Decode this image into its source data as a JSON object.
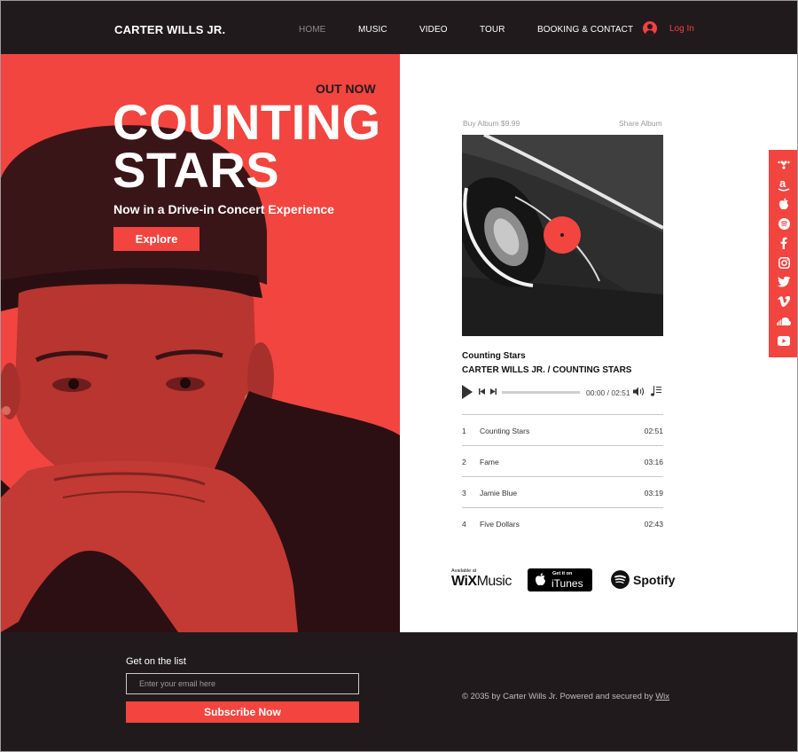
{
  "header": {
    "logo": "CARTER WILLS JR.",
    "nav": [
      {
        "label": "HOME",
        "active": true
      },
      {
        "label": "MUSIC",
        "active": false
      },
      {
        "label": "VIDEO",
        "active": false
      },
      {
        "label": "TOUR",
        "active": false
      },
      {
        "label": "BOOKING & CONTACT",
        "active": false
      }
    ],
    "login_label": "Log In",
    "login_icon": "user-avatar-icon"
  },
  "hero": {
    "out_now": "OUT NOW",
    "title_line1": "COUNTING",
    "title_line2": "STARS",
    "subtitle": "Now in a Drive-in Concert Experience",
    "cta_label": "Explore",
    "image_description": "Red-duotone portrait of man in cap, hands clasped over mouth"
  },
  "album": {
    "buy_label": "Buy Album $9.99",
    "share_label": "Share Album",
    "cover_description": "Black and white car wheel with red record dot"
  },
  "player": {
    "track_title": "Counting Stars",
    "track_artist": "CARTER WILLS JR. / COUNTING STARS",
    "time": "00:00 / 02:51",
    "progress": 0
  },
  "tracks": [
    {
      "num": "1",
      "name": "Counting Stars",
      "duration": "02:51"
    },
    {
      "num": "2",
      "name": "Fame",
      "duration": "03:16"
    },
    {
      "num": "3",
      "name": "Jamie Blue",
      "duration": "03:19"
    },
    {
      "num": "4",
      "name": "Five Dollars",
      "duration": "02:43"
    }
  ],
  "badges": {
    "wix_available": "Available at",
    "wix_brand_bold": "WiX",
    "wix_brand_light": "Music",
    "itunes_get": "Get it on",
    "itunes_label": "iTunes",
    "spotify_label": "Spotify"
  },
  "social": [
    "tidal-icon",
    "amazon-icon",
    "apple-icon",
    "spotify-icon",
    "facebook-icon",
    "instagram-icon",
    "twitter-icon",
    "vimeo-icon",
    "soundcloud-icon",
    "youtube-icon"
  ],
  "footer": {
    "list_heading": "Get on the list",
    "email_placeholder": "Enter your email here",
    "subscribe_label": "Subscribe Now",
    "copyright_text": "© 2035 by Carter Wills Jr. Powered and secured by ",
    "copyright_link": "Wix"
  },
  "colors": {
    "accent": "#f2453f",
    "dark": "#211a1d",
    "white": "#ffffff"
  }
}
